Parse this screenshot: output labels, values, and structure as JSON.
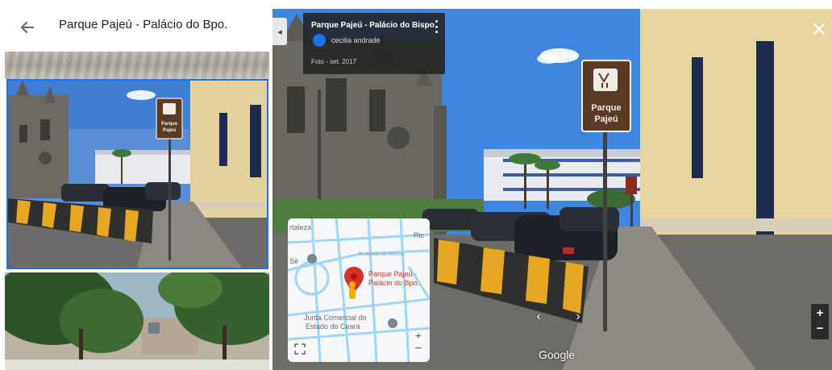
{
  "panel": {
    "title": "Parque Pajeú - Palácio do Bpo."
  },
  "thumbnail_sign": {
    "line1": "Parque",
    "line2": "Pajeú"
  },
  "viewer": {
    "info_card": {
      "place_title": "Parque Pajeú - Palácio do Bispo",
      "author": "cecilia andrade",
      "date": "Foto - set. 2017"
    },
    "sign": {
      "line1": "Parque",
      "line2": "Pajeú"
    },
    "google_label": "Google",
    "zoom_in": "+",
    "zoom_out": "−",
    "nav_left": "‹",
    "nav_right": "›"
  },
  "minimap": {
    "pin_label_line1": "Parque Pajeú -",
    "pin_label_line2": "Palácio do Bpo.",
    "label_junta_line1": "Junta Comercial do",
    "label_junta_line2": "Estado do Ceará",
    "label_fortaleza": "rtaleza",
    "label_ric": "Ric",
    "label_se": "Sé",
    "label_street": "R. Alfredo de Alencar",
    "zoom_in": "+",
    "zoom_out": "−"
  },
  "colors": {
    "accent_blue": "#1a73e8",
    "pin_red": "#d93025",
    "sign_brown": "#5b3b24",
    "barrier_yellow": "#e8a722"
  },
  "icons": {
    "back": "arrow-left-icon",
    "close": "close-icon",
    "menu": "more-vertical-icon",
    "expand": "expand-icon",
    "collapse": "chevron-left-icon"
  }
}
